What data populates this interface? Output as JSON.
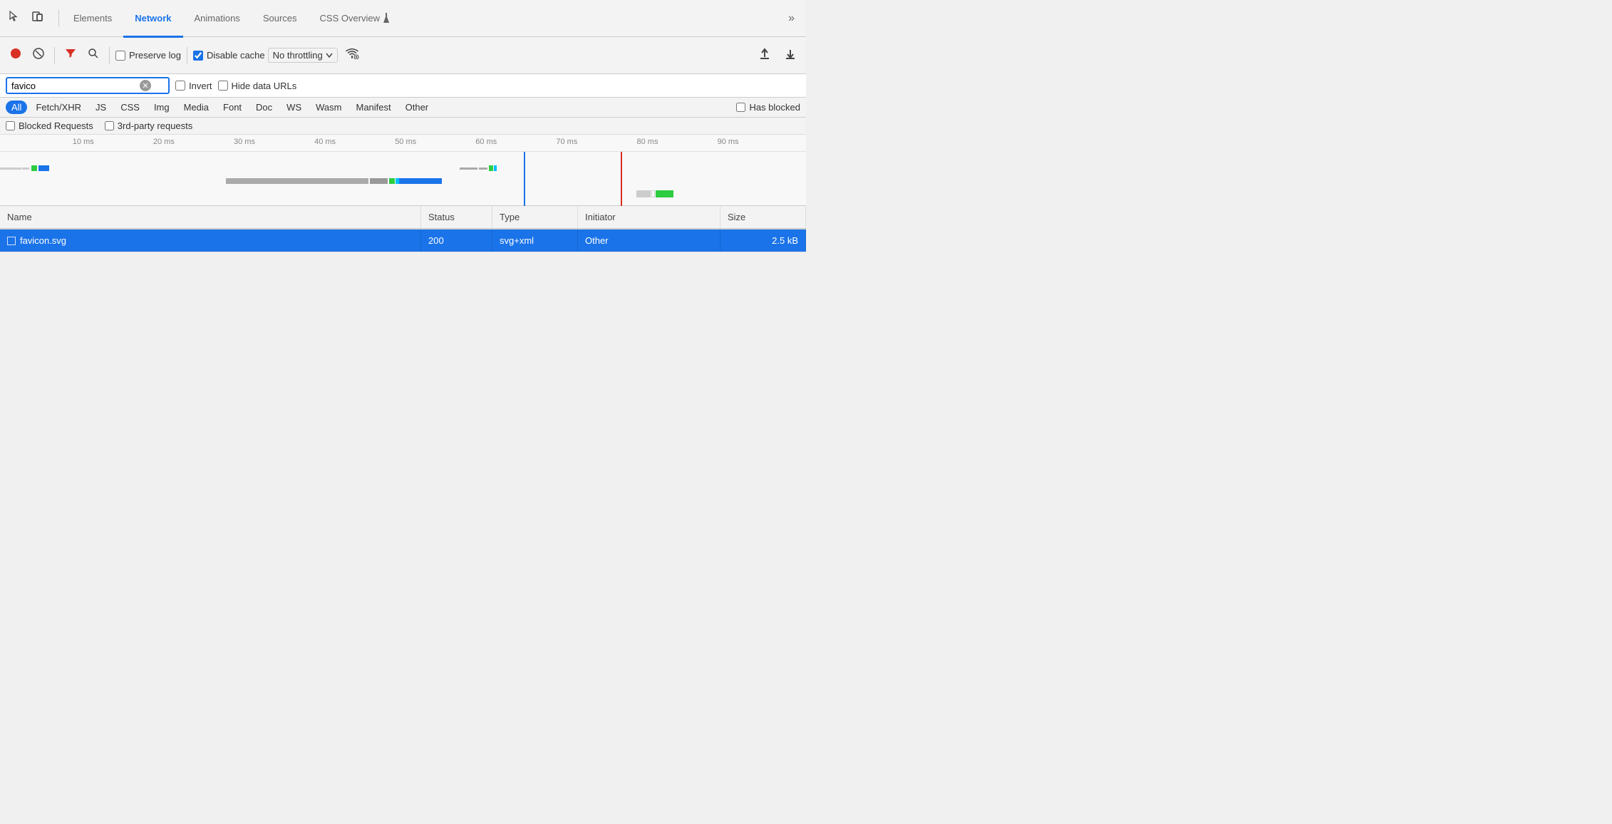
{
  "tabs": {
    "items": [
      {
        "label": "Elements",
        "active": false
      },
      {
        "label": "Network",
        "active": true
      },
      {
        "label": "Animations",
        "active": false
      },
      {
        "label": "Sources",
        "active": false
      },
      {
        "label": "CSS Overview",
        "active": false
      }
    ],
    "more_label": "»"
  },
  "toolbar": {
    "record_title": "Record network log",
    "stop_title": "Clear network log",
    "filter_title": "Filter",
    "search_title": "Search",
    "preserve_log_label": "Preserve log",
    "preserve_log_checked": false,
    "disable_cache_label": "Disable cache",
    "disable_cache_checked": true,
    "throttle_label": "No throttling",
    "wifi_icon": "wifi",
    "upload_label": "↑",
    "download_label": "↓"
  },
  "filter": {
    "search_value": "favico",
    "search_placeholder": "Filter",
    "invert_label": "Invert",
    "invert_checked": false,
    "hide_data_urls_label": "Hide data URLs",
    "hide_data_urls_checked": false
  },
  "type_filter": {
    "buttons": [
      {
        "label": "All",
        "active": true
      },
      {
        "label": "Fetch/XHR",
        "active": false
      },
      {
        "label": "JS",
        "active": false
      },
      {
        "label": "CSS",
        "active": false
      },
      {
        "label": "Img",
        "active": false
      },
      {
        "label": "Media",
        "active": false
      },
      {
        "label": "Font",
        "active": false
      },
      {
        "label": "Doc",
        "active": false
      },
      {
        "label": "WS",
        "active": false
      },
      {
        "label": "Wasm",
        "active": false
      },
      {
        "label": "Manifest",
        "active": false
      },
      {
        "label": "Other",
        "active": false
      }
    ],
    "has_blocked_label": "Has blocked"
  },
  "blocked_row": {
    "blocked_requests_label": "Blocked Requests",
    "third_party_label": "3rd-party requests"
  },
  "timeline": {
    "ticks": [
      {
        "label": "10 ms",
        "left_pct": 9
      },
      {
        "label": "20 ms",
        "left_pct": 19
      },
      {
        "label": "30 ms",
        "left_pct": 29
      },
      {
        "label": "40 ms",
        "left_pct": 39
      },
      {
        "label": "50 ms",
        "left_pct": 49
      },
      {
        "label": "60 ms",
        "left_pct": 59
      },
      {
        "label": "70 ms",
        "left_pct": 69
      },
      {
        "label": "80 ms",
        "left_pct": 79
      },
      {
        "label": "90 ms",
        "left_pct": 89
      }
    ]
  },
  "table": {
    "headers": [
      {
        "label": "Name"
      },
      {
        "label": "Status"
      },
      {
        "label": "Type"
      },
      {
        "label": "Initiator"
      },
      {
        "label": "Size"
      }
    ],
    "rows": [
      {
        "name": "favicon.svg",
        "status": "200",
        "type": "svg+xml",
        "initiator": "Other",
        "size": "2.5 kB",
        "selected": true
      }
    ]
  }
}
